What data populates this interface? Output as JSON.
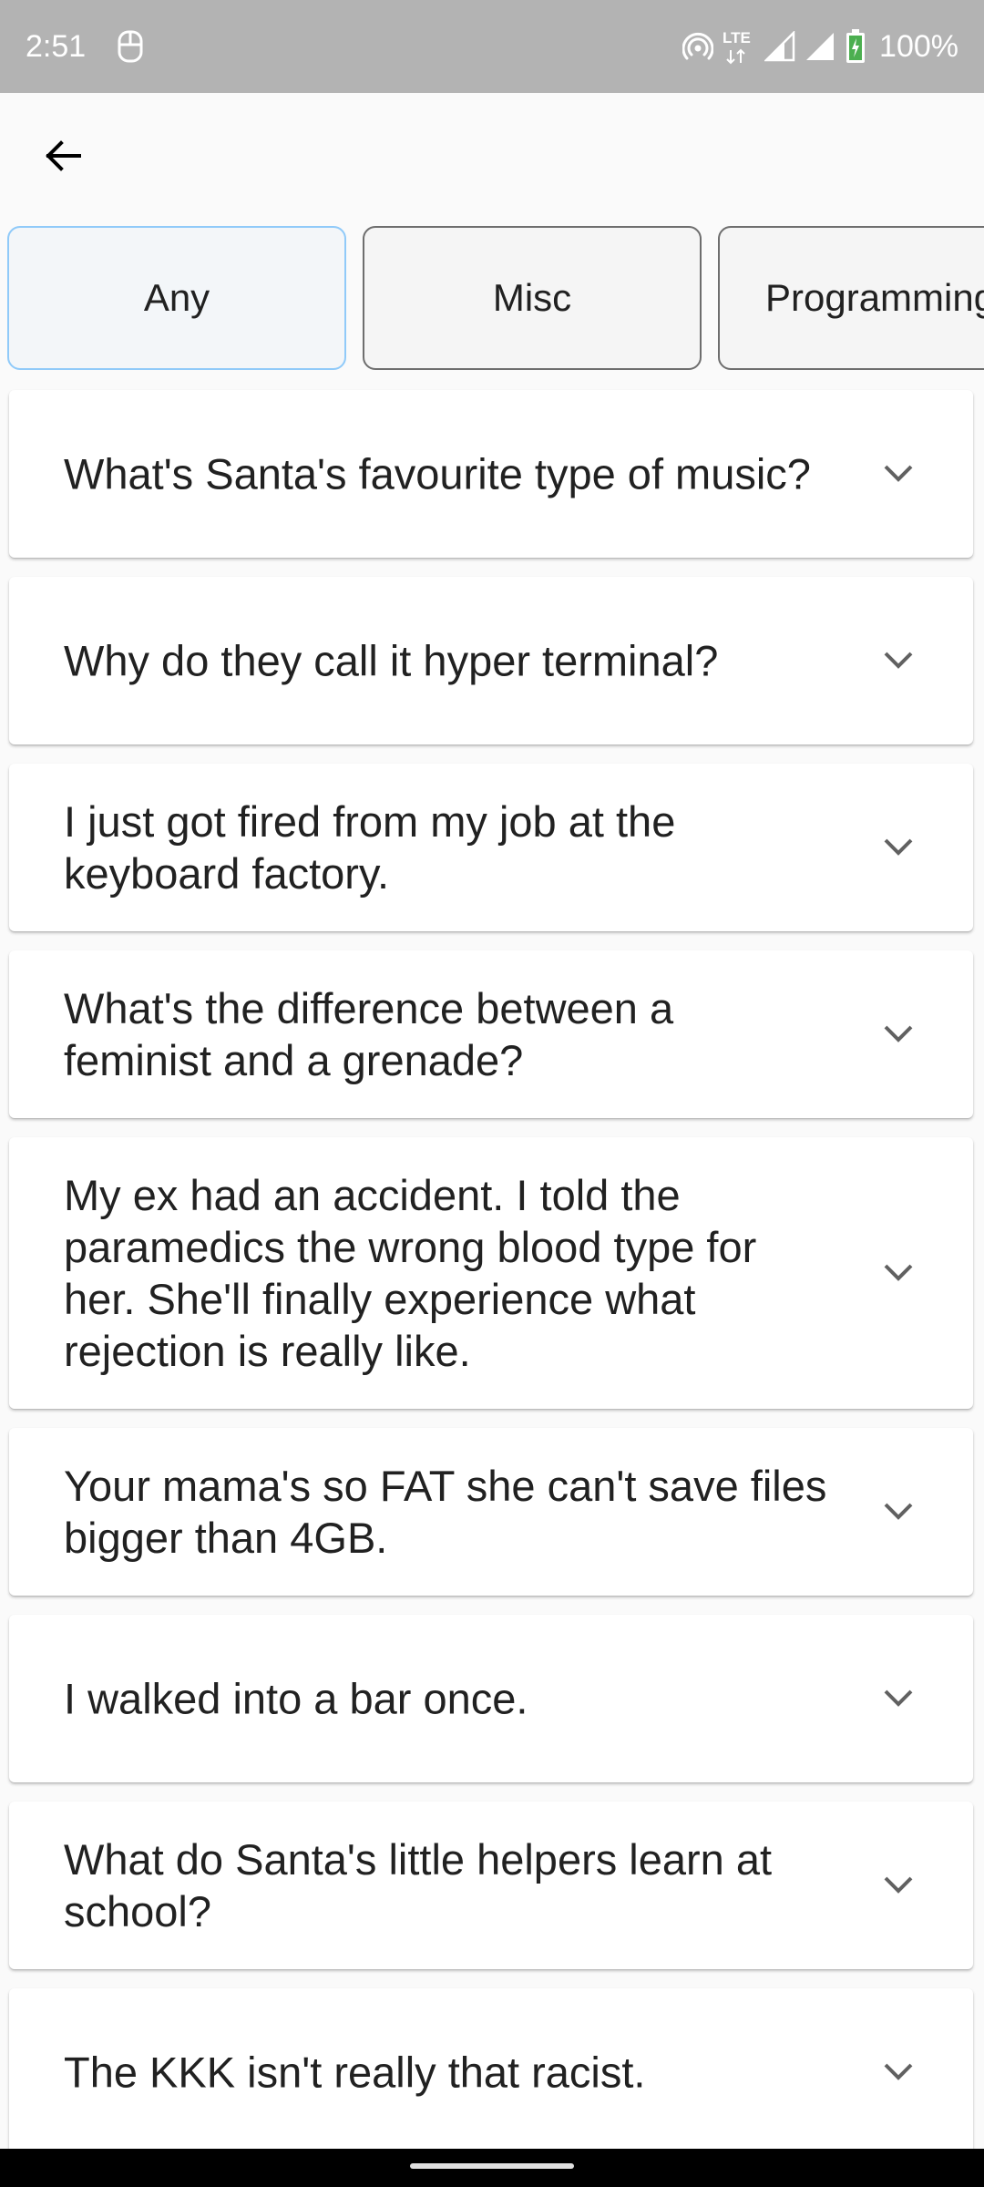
{
  "status_bar": {
    "time": "2:51",
    "left_icon": "keyboard-icon",
    "icons": [
      "hotspot-icon",
      "lte-icon",
      "signal-icon",
      "signal-icon",
      "battery-charging-icon"
    ],
    "lte_label": "LTE",
    "battery": "100%"
  },
  "app_bar": {
    "back_icon": "arrow-back-icon"
  },
  "categories": {
    "selected": "Any",
    "items": [
      {
        "label": "Any"
      },
      {
        "label": "Misc"
      },
      {
        "label": "Programming"
      }
    ]
  },
  "jokes": [
    {
      "text": "What's Santa's favourite type of music?"
    },
    {
      "text": "Why do they call it hyper terminal?"
    },
    {
      "text": "I just got fired from my job at the keyboard factory."
    },
    {
      "text": "What's the difference between a feminist and a grenade?"
    },
    {
      "text": "My ex had an accident. I told the paramedics the wrong blood type for her. She'll finally experience what rejection is really like."
    },
    {
      "text": "Your mama's so FAT she can't save files bigger than 4GB."
    },
    {
      "text": "I walked into a bar once."
    },
    {
      "text": "What do Santa's little helpers learn at school?"
    },
    {
      "text": "The KKK isn't really that racist."
    }
  ],
  "colors": {
    "status_bar": "#b3b3b3",
    "selected_chip_border": "#90caf9",
    "chip_border": "#6e6e6e",
    "text": "#212121",
    "battery_charge": "#4caf50"
  }
}
